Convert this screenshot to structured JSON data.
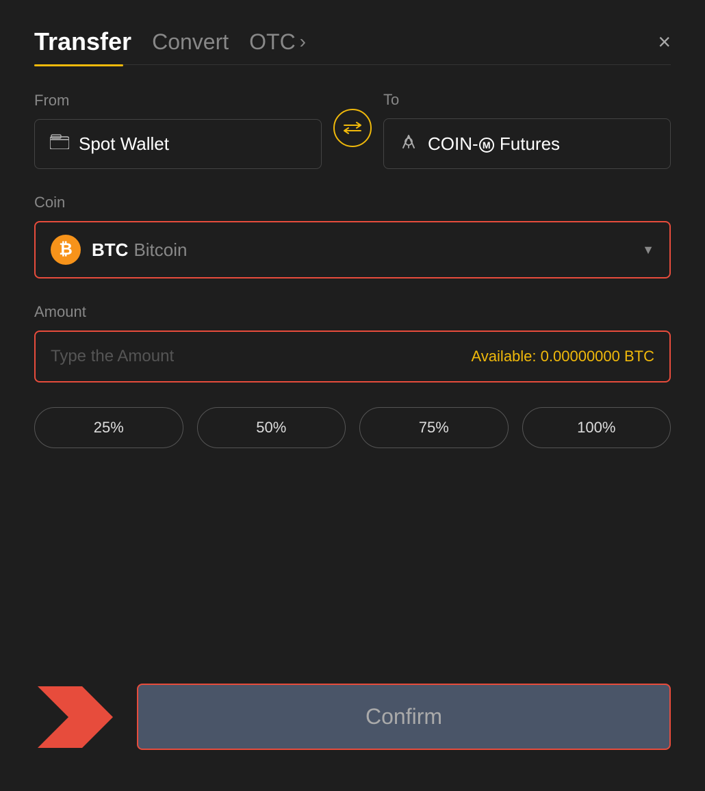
{
  "header": {
    "title": "Transfer",
    "tab_convert": "Convert",
    "tab_otc": "OTC",
    "tab_otc_chevron": "›",
    "close_label": "×"
  },
  "from": {
    "label": "From",
    "wallet_text": "Spot Wallet",
    "wallet_icon": "🪙"
  },
  "to": {
    "label": "To",
    "futures_text": "COIN-M Futures"
  },
  "coin": {
    "label": "Coin",
    "symbol": "BTC",
    "name": "Bitcoin",
    "btc_char": "₿"
  },
  "amount": {
    "label": "Amount",
    "placeholder": "Type the Amount",
    "available_label": "Available:",
    "available_value": "0.00000000 BTC"
  },
  "percent_buttons": [
    {
      "label": "25%"
    },
    {
      "label": "50%"
    },
    {
      "label": "75%"
    },
    {
      "label": "100%"
    }
  ],
  "confirm": {
    "label": "Confirm"
  }
}
